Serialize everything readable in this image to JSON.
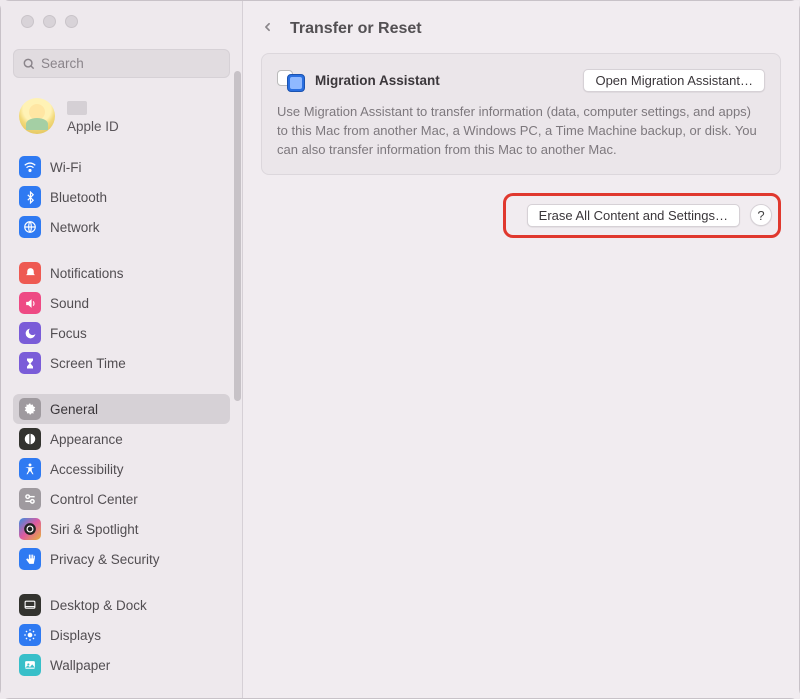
{
  "search": {
    "placeholder": "Search"
  },
  "apple_id_label": "Apple ID",
  "sidebar": {
    "items": [
      {
        "label": "Wi-Fi",
        "color": "#2f7af2",
        "icon": "wifi"
      },
      {
        "label": "Bluetooth",
        "color": "#2f7af2",
        "icon": "bluetooth"
      },
      {
        "label": "Network",
        "color": "#2f7af2",
        "icon": "globe"
      },
      {
        "label": "Notifications",
        "color": "#ee5a52",
        "icon": "bell"
      },
      {
        "label": "Sound",
        "color": "#ee4a84",
        "icon": "speaker"
      },
      {
        "label": "Focus",
        "color": "#7a5cd8",
        "icon": "moon"
      },
      {
        "label": "Screen Time",
        "color": "#7a5cd8",
        "icon": "hourglass"
      },
      {
        "label": "General",
        "color": "#9f9a9f",
        "icon": "gear",
        "selected": true
      },
      {
        "label": "Appearance",
        "color": "#33332f",
        "icon": "appearance"
      },
      {
        "label": "Accessibility",
        "color": "#2f7af2",
        "icon": "accessibility"
      },
      {
        "label": "Control Center",
        "color": "#9f9a9f",
        "icon": "switches"
      },
      {
        "label": "Siri & Spotlight",
        "color": "linear-gradient(135deg,#3a8de0,#e05aa0,#e6b23b)",
        "icon": "siri"
      },
      {
        "label": "Privacy & Security",
        "color": "#2f7af2",
        "icon": "hand"
      },
      {
        "label": "Desktop & Dock",
        "color": "#33332f",
        "icon": "dock"
      },
      {
        "label": "Displays",
        "color": "#2f7af2",
        "icon": "sun"
      },
      {
        "label": "Wallpaper",
        "color": "#38bfc9",
        "icon": "wallpaper"
      }
    ]
  },
  "page": {
    "title": "Transfer or Reset",
    "migration": {
      "title": "Migration Assistant",
      "button": "Open Migration Assistant…",
      "desc": "Use Migration Assistant to transfer information (data, computer settings, and apps) to this Mac from another Mac, a Windows PC, a Time Machine backup, or disk. You can also transfer information from this Mac to another Mac."
    },
    "erase": {
      "button": "Erase All Content and Settings…",
      "help": "?"
    }
  }
}
